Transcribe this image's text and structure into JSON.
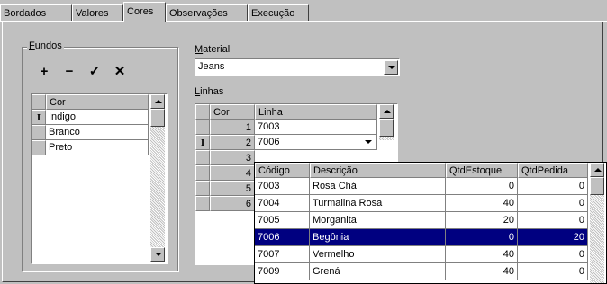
{
  "tabs": [
    "Bordados",
    "Valores",
    "Cores",
    "Observações",
    "Execução"
  ],
  "active_tab": "Cores",
  "fundos": {
    "label_first": "F",
    "label_rest": "undos",
    "nav_buttons": [
      {
        "icon": "plus-icon",
        "glyph": "+"
      },
      {
        "icon": "minus-icon",
        "glyph": "−"
      },
      {
        "icon": "check-icon",
        "glyph": "✓"
      },
      {
        "icon": "cancel-icon",
        "glyph": "✕"
      }
    ],
    "header": "Cor",
    "current_marker": "I",
    "rows": [
      "Indigo",
      "Branco",
      "Preto"
    ]
  },
  "material": {
    "label_first": "M",
    "label_rest": "aterial",
    "value": "Jeans"
  },
  "linhas": {
    "label_first": "L",
    "label_rest": "inhas",
    "headers": [
      "Cor",
      "Linha"
    ],
    "current_marker": "I",
    "rows": [
      {
        "cor": "1",
        "linha": "7003"
      },
      {
        "cor": "2",
        "linha": "7006"
      },
      {
        "cor": "3",
        "linha": ""
      },
      {
        "cor": "4",
        "linha": ""
      },
      {
        "cor": "5",
        "linha": ""
      },
      {
        "cor": "6",
        "linha": ""
      }
    ]
  },
  "lookup": {
    "headers": [
      "Código",
      "Descrição",
      "QtdEstoque",
      "QtdPedida"
    ],
    "rows": [
      {
        "codigo": "7003",
        "descricao": "Rosa Chá",
        "estoque": "0",
        "pedida": "0"
      },
      {
        "codigo": "7004",
        "descricao": "Turmalina Rosa",
        "estoque": "40",
        "pedida": "0"
      },
      {
        "codigo": "7005",
        "descricao": "Morganita",
        "estoque": "20",
        "pedida": "0"
      },
      {
        "codigo": "7006",
        "descricao": "Begônia",
        "estoque": "0",
        "pedida": "20"
      },
      {
        "codigo": "7007",
        "descricao": "Vermelho",
        "estoque": "40",
        "pedida": "0"
      },
      {
        "codigo": "7009",
        "descricao": "Grená",
        "estoque": "40",
        "pedida": "0"
      }
    ],
    "selected_index": 3
  },
  "colors": {
    "selection": "#000080",
    "face": "#c0c0c0"
  }
}
